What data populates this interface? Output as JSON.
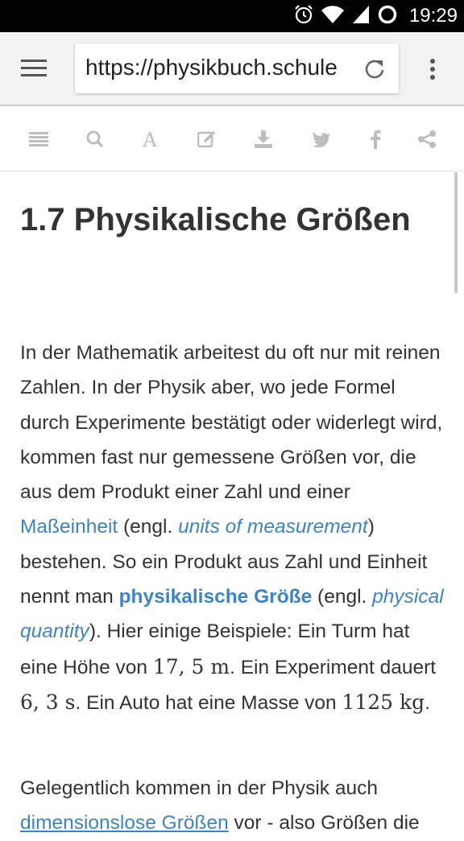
{
  "status_bar": {
    "time": "19:29",
    "icons": [
      "alarm-icon",
      "wifi-icon",
      "signal-icon",
      "sync-icon"
    ]
  },
  "browser": {
    "url": "https://physikbuch.schule"
  },
  "toolbar": {
    "icons": [
      "list-icon",
      "search-icon",
      "font-icon",
      "edit-icon",
      "download-icon",
      "twitter-icon",
      "facebook-icon",
      "share-icon"
    ]
  },
  "article": {
    "title": "1.7   Physikalische Größen",
    "p1": {
      "t1": "In der Mathematik arbeitest du oft nur mit reinen Zahlen. In der Physik aber, wo jede Formel durch Experimente bestätigt oder widerlegt wird, kommen fast nur gemessene Größen vor, die aus dem Produkt einer Zahl und einer ",
      "link1": "Maßeinheit",
      "t2": " (engl. ",
      "em1": "units of measurement",
      "t3": ") bestehen. So ein Produkt aus Zahl und Einheit nennt man ",
      "strong1": "physikalische Größe",
      "t4": " (engl. ",
      "em2": "physical quantity",
      "t5": "). Hier einige Beispiele: Ein Turm hat eine Höhe von ",
      "m1": "17, 5 m",
      "t6": ". Ein Experiment dauert ",
      "m2": "6, 3 s",
      "t7": ". Ein Auto hat eine Masse von ",
      "m3": "1125 kg",
      "t8": "."
    },
    "p2": {
      "t1": "Gelegentlich kommen in der Physik auch ",
      "link1": "dimensionslose Größen",
      "t2": " vor - also Größen die"
    }
  },
  "colors": {
    "link": "#3e84c4",
    "text": "#333333",
    "icon": "#bdbdbd"
  }
}
